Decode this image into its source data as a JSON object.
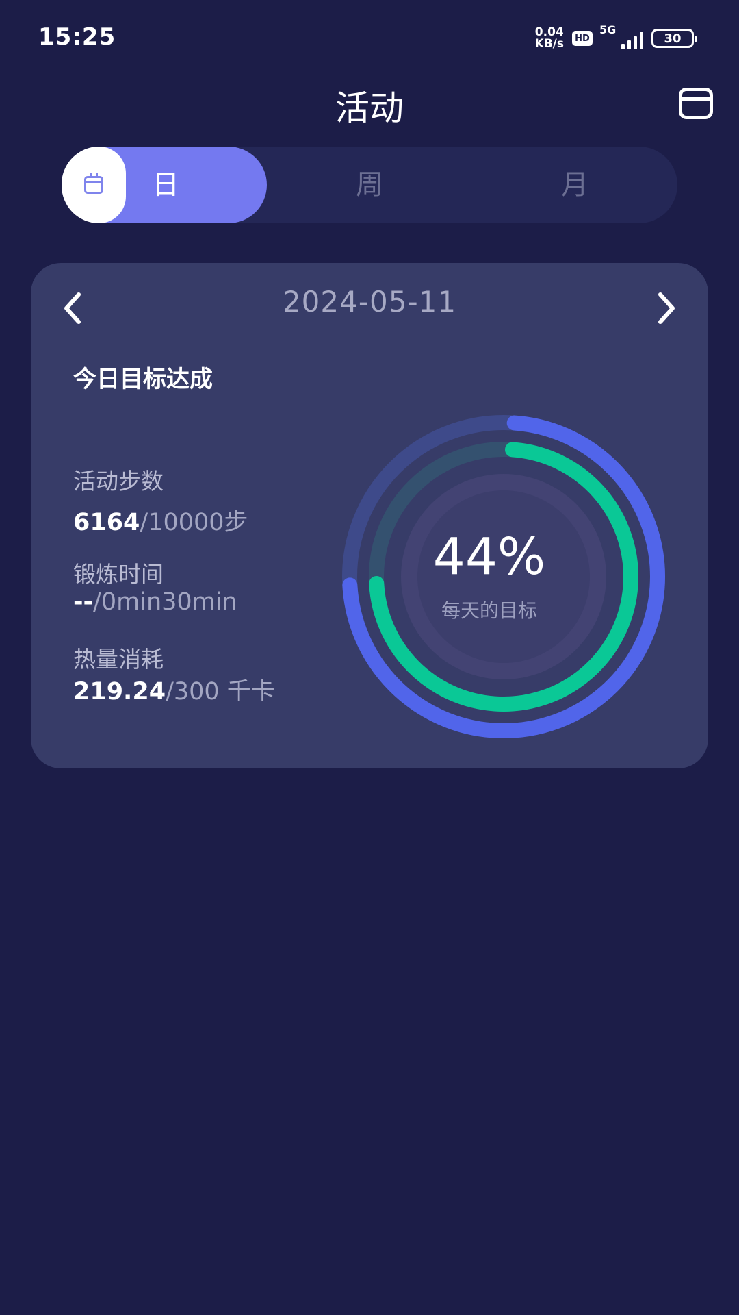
{
  "status_bar": {
    "time": "15:25",
    "net_speed_value": "0.04",
    "net_speed_unit": "KB/s",
    "hd_badge": "HD",
    "network": "5G",
    "battery": "30"
  },
  "header": {
    "title": "活动",
    "calendar_icon": "calendar-icon"
  },
  "tabs": [
    {
      "label": "日",
      "active": true
    },
    {
      "label": "周",
      "active": false
    },
    {
      "label": "月",
      "active": false
    }
  ],
  "card": {
    "date": "2024-05-11",
    "goal_title": "今日目标达成",
    "metrics": [
      {
        "label": "活动步数",
        "value": "6164",
        "target": "/10000步"
      },
      {
        "label": "锻炼时间",
        "value": "--",
        "target": "/0min30min"
      },
      {
        "label": "热量消耗",
        "value": "219.24",
        "target": "/300 千卡"
      }
    ],
    "ring": {
      "percent_text": "44%",
      "caption": "每天的目标",
      "outer_progress": 0.73,
      "inner_progress": 0.73
    }
  },
  "colors": {
    "background": "#1c1d48",
    "card": "#373c68",
    "tab_active": "#7479f0",
    "ring_blue": "#5165ea",
    "ring_green": "#0ac896"
  }
}
